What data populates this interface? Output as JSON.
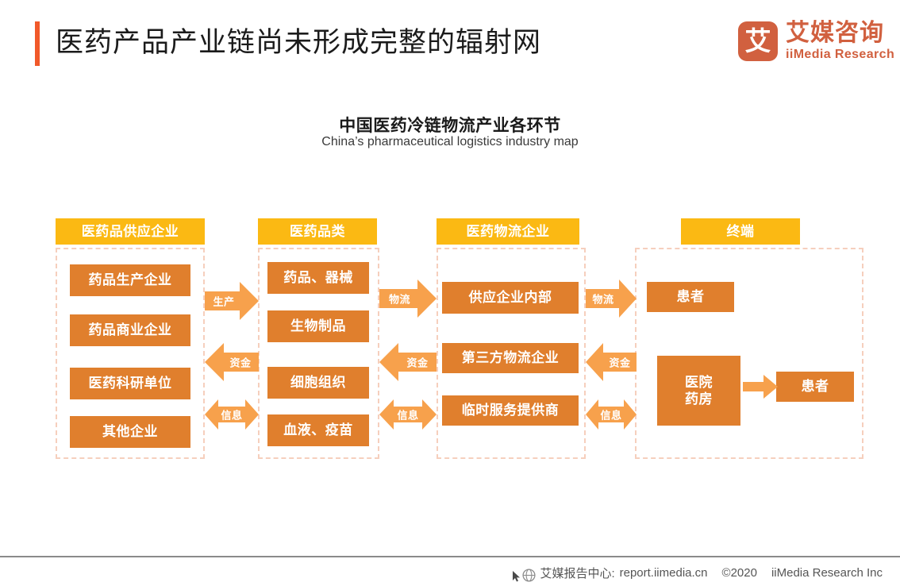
{
  "header": {
    "title": "医药产品产业链尚未形成完整的辐射网",
    "accent_color": "#f1592a",
    "logo": {
      "mark_glyph": "艾",
      "name_cn": "艾媒咨询",
      "name_en": "iiMedia Research",
      "color": "#d1603f"
    }
  },
  "chart_data": {
    "type": "diagram",
    "title": "中国医药冷链物流产业各环节",
    "subtitle": "China’s pharmaceutical logistics industry map",
    "colors": {
      "header_band": "#fbb913",
      "node": "#e07f2d",
      "arrow": "#f7a14c",
      "dashed_border": "#f6cfbd"
    },
    "columns": [
      {
        "header": "医药品供应企业",
        "nodes": [
          "药品生产企业",
          "药品商业企业",
          "医药科研单位",
          "其他企业"
        ]
      },
      {
        "header": "医药品类",
        "nodes": [
          "药品、器械",
          "生物制品",
          "细胞组织",
          "血液、疫苗"
        ]
      },
      {
        "header": "医药物流企业",
        "nodes": [
          "供应企业内部",
          "第三方物流企业",
          "临时服务提供商"
        ]
      },
      {
        "header": "终端",
        "nodes": [
          "患者",
          "医院\n药房",
          "患者"
        ]
      }
    ],
    "connectors": [
      {
        "between": "医药品供应企业 → 医药品类",
        "labels": [
          "生产",
          "资金",
          "信息"
        ],
        "directions": [
          "right",
          "left",
          "both"
        ]
      },
      {
        "between": "医药品类 → 医药物流企业",
        "labels": [
          "物流",
          "资金",
          "信息"
        ],
        "directions": [
          "right",
          "left",
          "both"
        ]
      },
      {
        "between": "医药物流企业 → 终端",
        "labels": [
          "物流",
          "资金",
          "信息"
        ],
        "directions": [
          "right",
          "left",
          "both"
        ]
      },
      {
        "between": "医院药房 → 患者",
        "labels": [
          ""
        ],
        "directions": [
          "right"
        ]
      }
    ],
    "connector_labels": {
      "c1a": "生产",
      "c1b": "资金",
      "c1c": "信息",
      "c2a": "物流",
      "c2b": "资金",
      "c2c": "信息",
      "c3a": "物流",
      "c3b": "资金",
      "c3c": "信息"
    },
    "col1": {
      "header": "医药品供应企业",
      "n0": "药品生产企业",
      "n1": "药品商业企业",
      "n2": "医药科研单位",
      "n3": "其他企业"
    },
    "col2": {
      "header": "医药品类",
      "n0": "药品、器械",
      "n1": "生物制品",
      "n2": "细胞组织",
      "n3": "血液、疫苗"
    },
    "col3": {
      "header": "医药物流企业",
      "n0": "供应企业内部",
      "n1": "第三方物流企业",
      "n2": "临时服务提供商"
    },
    "col4": {
      "header": "终端",
      "n0": "患者",
      "n1_line1": "医院",
      "n1_line2": "药房",
      "n2": "患者"
    }
  },
  "footer": {
    "report_center": "艾媒报告中心:",
    "url": "report.iimedia.cn",
    "copyright": "©2020",
    "company": "iiMedia Research  Inc"
  }
}
